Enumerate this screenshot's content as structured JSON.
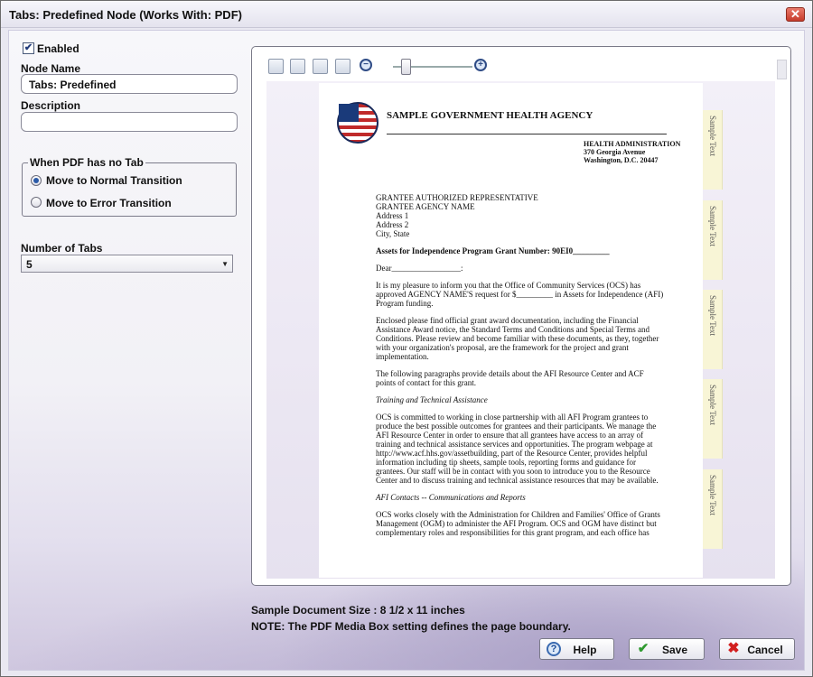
{
  "window": {
    "title": "Tabs: Predefined Node (Works With: PDF)"
  },
  "form": {
    "enabled_label": "Enabled",
    "enabled_checked": true,
    "node_name_label": "Node Name",
    "node_name_value": "Tabs: Predefined",
    "description_label": "Description",
    "description_value": "",
    "no_tab_group_label": "When PDF has no Tab",
    "radio_normal_label": "Move to Normal Transition",
    "radio_error_label": "Move to Error Transition",
    "selected_radio": "normal",
    "number_of_tabs_label": "Number of Tabs",
    "number_of_tabs_value": "5"
  },
  "preview": {
    "toolbar_icons": [
      "image-icon",
      "fit-page-icon",
      "fit-width-icon",
      "single-page-icon",
      "zoom-out-icon",
      "zoom-slider",
      "zoom-in-icon"
    ],
    "zoom_level_fraction": 0.1,
    "document": {
      "agency": "SAMPLE GOVERNMENT HEALTH AGENCY",
      "dept_line1": "HEALTH ADMINISTRATION",
      "dept_line2": "370 Georgia Avenue",
      "dept_line3": "Washington, D.C. 20447",
      "addr1": "GRANTEE AUTHORIZED REPRESENTATIVE",
      "addr2": "GRANTEE AGENCY NAME",
      "addr3": "Address 1",
      "addr4": "Address 2",
      "addr5": "City, State",
      "subject": "Assets for Independence Program Grant Number:  90EI0_________",
      "dear": "Dear_________________:",
      "p1": "It is my pleasure to inform you that the Office of Community Services (OCS) has approved AGENCY NAME'S  request for $_________ in Assets for Independence (AFI) Program funding.",
      "p2": "Enclosed please find official grant award documentation, including the Financial Assistance Award notice, the Standard Terms and Conditions and Special Terms and Conditions.  Please review and become familiar with these documents, as they, together with your organization's proposal, are the framework for the project and grant implementation.",
      "p3": "The following paragraphs provide details about the AFI Resource Center and ACF points of contact for this grant.",
      "h1": "Training and Technical Assistance",
      "p4": "OCS is committed to working in close partnership with all AFI Program grantees to produce the best possible outcomes for grantees and their participants.  We manage the AFI Resource Center in order to ensure that all grantees have access to an array of training and technical assistance services and opportunities.   The program webpage at http://www.acf.hhs.gov/assetbuilding, part of the Resource Center, provides helpful information including tip sheets, sample tools, reporting forms and guidance for grantees. Our staff will be in contact with you soon to introduce you to the Resource Center and to discuss training and technical assistance resources that may be available.",
      "h2": "AFI Contacts -- Communications and Reports",
      "p5": "OCS works closely with the Administration for Children and Families' Office of Grants Management (OGM) to administer the AFI Program.  OCS and OGM have distinct but complementary roles and responsibilities for this grant program, and each office has"
    },
    "tabs": [
      "Sample Text",
      "Sample Text",
      "Sample Text",
      "Sample Text",
      "Sample Text"
    ]
  },
  "footer": {
    "size_note": "Sample Document Size : 8 1/2 x 11 inches",
    "media_note": "NOTE: The PDF Media Box setting defines the page boundary.",
    "help_label": "Help",
    "save_label": "Save",
    "cancel_label": "Cancel"
  }
}
